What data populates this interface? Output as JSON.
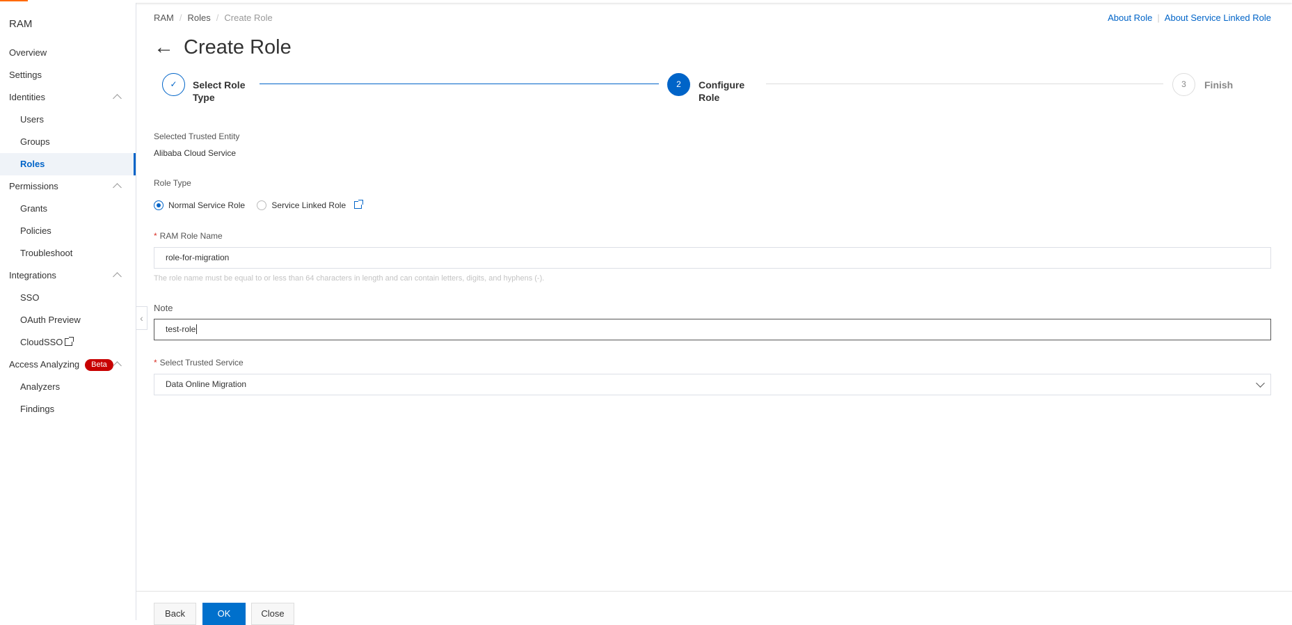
{
  "sidebar": {
    "title": "RAM",
    "items": [
      {
        "label": "Overview"
      },
      {
        "label": "Settings"
      },
      {
        "label": "Identities"
      },
      {
        "label": "Users"
      },
      {
        "label": "Groups"
      },
      {
        "label": "Roles"
      },
      {
        "label": "Permissions"
      },
      {
        "label": "Grants"
      },
      {
        "label": "Policies"
      },
      {
        "label": "Troubleshoot"
      },
      {
        "label": "Integrations"
      },
      {
        "label": "SSO"
      },
      {
        "label": "OAuth Preview"
      },
      {
        "label": "CloudSSO"
      },
      {
        "label": "Access Analyzing",
        "badge": "Beta"
      },
      {
        "label": "Analyzers"
      },
      {
        "label": "Findings"
      }
    ]
  },
  "breadcrumb": [
    "RAM",
    "Roles",
    "Create Role"
  ],
  "links": {
    "about_role": "About Role",
    "about_slr": "About Service Linked Role"
  },
  "page_title": "Create Role",
  "steps": [
    {
      "num": "1",
      "label": "Select Role Type",
      "status": "done"
    },
    {
      "num": "2",
      "label": "Configure Role",
      "status": "active"
    },
    {
      "num": "3",
      "label": "Finish",
      "status": "pending"
    }
  ],
  "form": {
    "entity_label": "Selected Trusted Entity",
    "entity_value": "Alibaba Cloud Service",
    "role_type_label": "Role Type",
    "role_type_options": [
      "Normal Service Role",
      "Service Linked Role"
    ],
    "role_type_selected": "Normal Service Role",
    "name_label": "RAM Role Name",
    "name_value": "role-for-migration",
    "name_hint": "The role name must be equal to or less than 64 characters in length and can contain letters, digits, and hyphens (-).",
    "note_label": "Note",
    "note_value": "test-role",
    "service_label": "Select Trusted Service",
    "service_value": "Data Online Migration"
  },
  "footer": {
    "back": "Back",
    "ok": "OK",
    "close": "Close"
  },
  "colors": {
    "primary": "#0064c8",
    "brand": "#ff6a00",
    "beta": "#c80000"
  }
}
